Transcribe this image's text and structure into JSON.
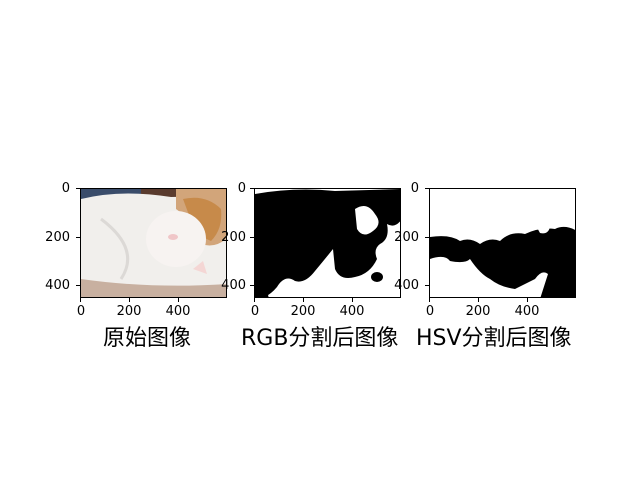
{
  "panels": [
    {
      "title": "原始图像",
      "x_ticks": [
        "0",
        "200",
        "400"
      ],
      "y_ticks": [
        "0",
        "200",
        "400"
      ]
    },
    {
      "title": "RGB分割后图像",
      "x_ticks": [
        "0",
        "200",
        "400"
      ],
      "y_ticks": [
        "0",
        "200",
        "400"
      ]
    },
    {
      "title": "HSV分割后图像",
      "x_ticks": [
        "0",
        "200",
        "400"
      ],
      "y_ticks": [
        "0",
        "200",
        "400"
      ]
    }
  ]
}
